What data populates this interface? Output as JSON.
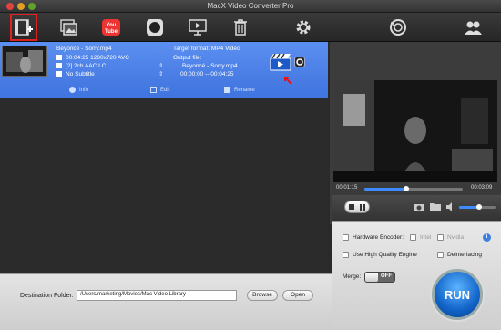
{
  "window": {
    "title": "MacX Video Converter Pro"
  },
  "toolbar": {
    "buttons": [
      {
        "name": "add-video-button",
        "icon": "film-plus-icon"
      },
      {
        "name": "add-photo-button",
        "icon": "photos-icon"
      },
      {
        "name": "youtube-button",
        "icon": "youtube-icon",
        "text": "You Tube"
      },
      {
        "name": "record-button",
        "icon": "record-icon"
      },
      {
        "name": "screen-record-button",
        "icon": "monitor-icon"
      },
      {
        "name": "delete-button",
        "icon": "trash-icon"
      },
      {
        "name": "settings-button",
        "icon": "gear-icon"
      },
      {
        "name": "update-button",
        "icon": "refresh-globe-icon"
      },
      {
        "name": "users-button",
        "icon": "users-icon"
      }
    ]
  },
  "file": {
    "name": "Beyoncé - Sorry.mp4",
    "duration_res": "00:04:25 1280x720 AVC",
    "audio": "[2] 2ch AAC LC",
    "subtitle": "No Subtitle",
    "target_format": "Target format: MP4 Video",
    "output_label": "Output file:",
    "output_file": "Beyoncé - Sorry.mp4",
    "output_time": "00:00:00 -- 00:04:25"
  },
  "row_actions": {
    "info": "Info",
    "edit": "Edit",
    "rename": "Rename"
  },
  "player": {
    "current_time": "00:01:15",
    "total_time": "00:03:09",
    "progress": 0.43,
    "volume": 0.55
  },
  "settings": {
    "hardware_encoder": "Hardware Encoder:",
    "intel": "Intel",
    "nvidia": "Nvidia",
    "high_quality": "Use High Quality Engine",
    "deinterlacing": "Deinterlacing",
    "merge": "Merge:",
    "merge_state": "OFF"
  },
  "bottom": {
    "dest_label": "Destination Folder:",
    "dest_path": "/Users/marketing/Movies/Mac Video Library",
    "browse": "Browse",
    "open": "Open"
  },
  "run": {
    "label": "RUN"
  },
  "colors": {
    "accent": "#4a7ee6",
    "run": "#1a6fd4",
    "highlight": "#dd2222"
  }
}
